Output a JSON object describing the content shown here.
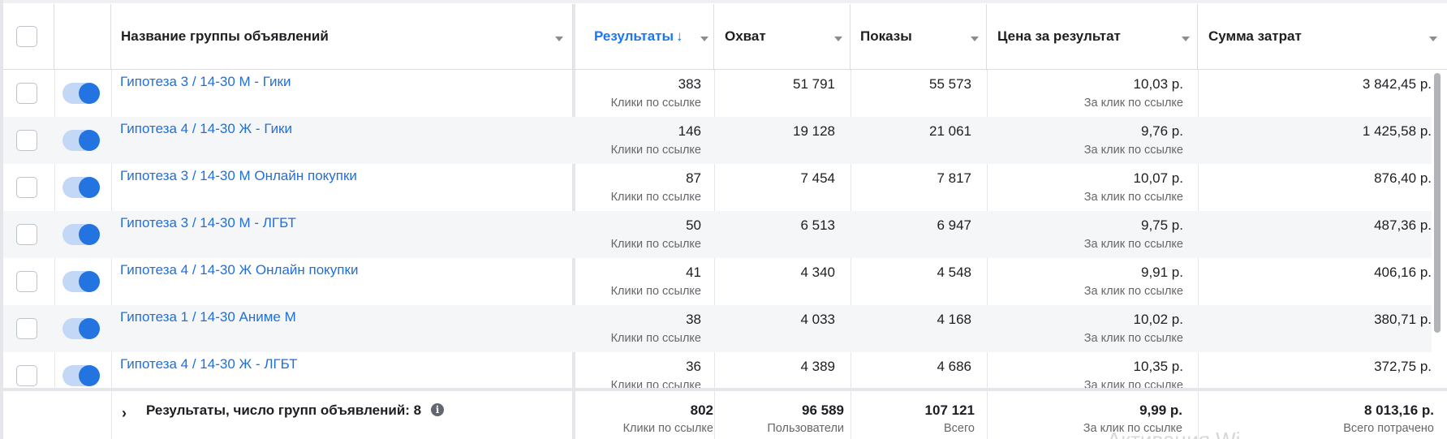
{
  "header": {
    "name": "Название группы объявлений",
    "results": "Результаты",
    "results_sort_indicator": "↓",
    "reach": "Охват",
    "impressions": "Показы",
    "cost_per_result": "Цена за результат",
    "amount_spent": "Сумма затрат"
  },
  "rows": [
    {
      "name": "Гипотеза 3 / 14-30 М - Гики",
      "results": "383",
      "results_sub": "Клики по ссылке",
      "reach": "51 791",
      "impressions": "55 573",
      "cost": "10,03 р.",
      "cost_sub": "За клик по ссылке",
      "spent": "3 842,45 р."
    },
    {
      "name": "Гипотеза 4 / 14-30 Ж - Гики",
      "results": "146",
      "results_sub": "Клики по ссылке",
      "reach": "19 128",
      "impressions": "21 061",
      "cost": "9,76 р.",
      "cost_sub": "За клик по ссылке",
      "spent": "1 425,58 р."
    },
    {
      "name": "Гипотеза 3 / 14-30 М Онлайн покупки",
      "results": "87",
      "results_sub": "Клики по ссылке",
      "reach": "7 454",
      "impressions": "7 817",
      "cost": "10,07 р.",
      "cost_sub": "За клик по ссылке",
      "spent": "876,40 р."
    },
    {
      "name": "Гипотеза 3 / 14-30 М - ЛГБТ",
      "results": "50",
      "results_sub": "Клики по ссылке",
      "reach": "6 513",
      "impressions": "6 947",
      "cost": "9,75 р.",
      "cost_sub": "За клик по ссылке",
      "spent": "487,36 р."
    },
    {
      "name": "Гипотеза 4 / 14-30 Ж Онлайн покупки",
      "results": "41",
      "results_sub": "Клики по ссылке",
      "reach": "4 340",
      "impressions": "4 548",
      "cost": "9,91 р.",
      "cost_sub": "За клик по ссылке",
      "spent": "406,16 р."
    },
    {
      "name": "Гипотеза 1 / 14-30 Аниме М",
      "results": "38",
      "results_sub": "Клики по ссылке",
      "reach": "4 033",
      "impressions": "4 168",
      "cost": "10,02 р.",
      "cost_sub": "За клик по ссылке",
      "spent": "380,71 р."
    },
    {
      "name": "Гипотеза 4 / 14-30 Ж - ЛГБТ",
      "results": "36",
      "results_sub": "Клики по ссылке",
      "reach": "4 389",
      "impressions": "4 686",
      "cost": "10,35 р.",
      "cost_sub": "За клик по ссылке",
      "spent": "372,75 р."
    }
  ],
  "footer": {
    "label": "Результаты, число групп объявлений: 8",
    "results": "802",
    "results_sub": "Клики по ссылке",
    "reach": "96 589",
    "reach_sub": "Пользователи",
    "impressions": "107 121",
    "impressions_sub": "Всего",
    "cost": "9,99 р.",
    "cost_sub": "За клик по ссылке",
    "spent": "8 013,16 р.",
    "spent_sub": "Всего потрачено",
    "watermark": "Активация Wi"
  },
  "colors": {
    "link": "#216fdb",
    "accent": "#1877f2",
    "toggle_on": "#2374e1",
    "row_alt": "#f5f6f7"
  }
}
